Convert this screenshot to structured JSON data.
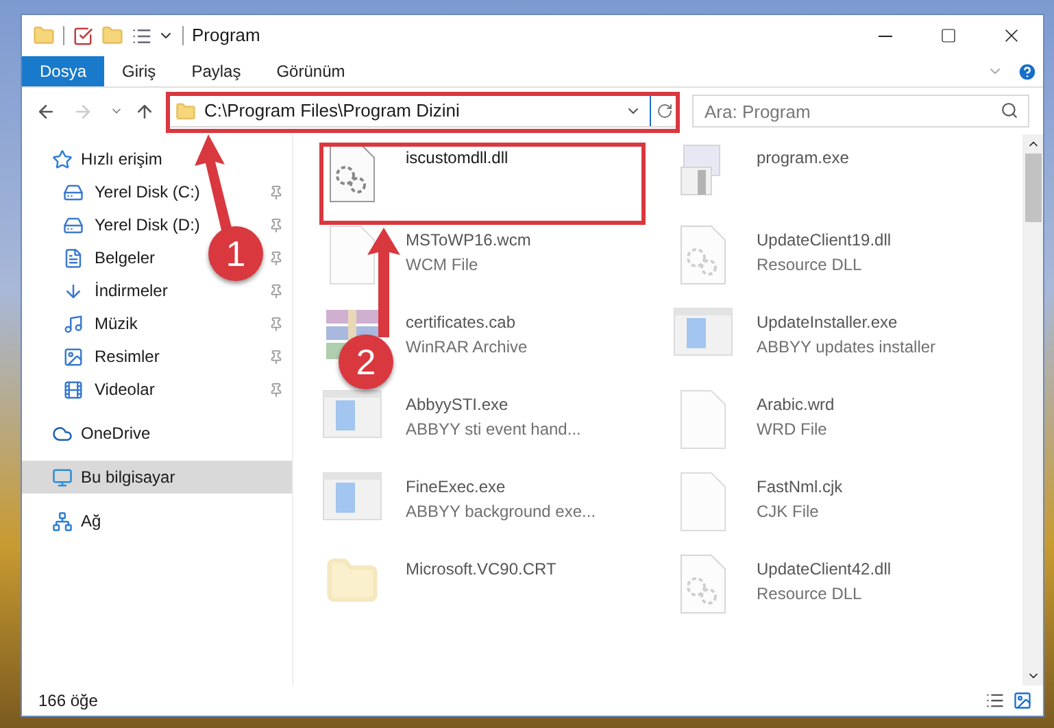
{
  "window": {
    "title": "Program"
  },
  "ribbon_tabs": [
    {
      "label": "Dosya",
      "selected": true
    },
    {
      "label": "Giriş",
      "selected": false
    },
    {
      "label": "Paylaş",
      "selected": false
    },
    {
      "label": "Görünüm",
      "selected": false
    }
  ],
  "address_bar": {
    "path": "C:\\Program Files\\Program Dizini"
  },
  "search": {
    "placeholder": "Ara: Program"
  },
  "sidebar": {
    "items": [
      {
        "label": "Hızlı erişim",
        "selected": false,
        "children": [
          {
            "label": "Yerel Disk (C:)",
            "pinned": true
          },
          {
            "label": "Yerel Disk (D:)",
            "pinned": true
          },
          {
            "label": "Belgeler",
            "pinned": true
          },
          {
            "label": "İndirmeler",
            "pinned": true
          },
          {
            "label": "Müzik",
            "pinned": true
          },
          {
            "label": "Resimler",
            "pinned": true
          },
          {
            "label": "Videolar",
            "pinned": true
          }
        ]
      },
      {
        "label": "OneDrive",
        "selected": false
      },
      {
        "label": "Bu bilgisayar",
        "selected": true
      },
      {
        "label": "Ağ",
        "selected": false
      }
    ]
  },
  "files": [
    {
      "name": "iscustomdll.dll",
      "kind": "dll",
      "blurred": false
    },
    {
      "name": "program.exe",
      "kind": "exe",
      "blurred": true
    },
    {
      "name": "MSToWP16.wcm",
      "type": "WCM File",
      "kind": "file",
      "blurred": true
    },
    {
      "name": "UpdateClient19.dll",
      "type": "Resource DLL",
      "kind": "dll",
      "blurred": true
    },
    {
      "name": "certificates.cab",
      "type": "WinRAR Archive",
      "kind": "archive",
      "blurred": true
    },
    {
      "name": "UpdateInstaller.exe",
      "type": "ABBYY updates installer",
      "kind": "app",
      "blurred": true
    },
    {
      "name": "AbbyySTI.exe",
      "type": "ABBYY sti event hand...",
      "kind": "app",
      "blurred": true
    },
    {
      "name": "Arabic.wrd",
      "type": "WRD File",
      "kind": "file",
      "blurred": true
    },
    {
      "name": "FineExec.exe",
      "type": "ABBYY background exe...",
      "kind": "app",
      "blurred": true
    },
    {
      "name": "FastNml.cjk",
      "type": "CJK File",
      "kind": "file",
      "blurred": true
    },
    {
      "name": "Microsoft.VC90.CRT",
      "kind": "folder",
      "blurred": true
    },
    {
      "name": "UpdateClient42.dll",
      "type": "Resource DLL",
      "kind": "dll",
      "blurred": true
    }
  ],
  "annotations": [
    {
      "label": "1"
    },
    {
      "label": "2"
    }
  ],
  "status_bar": {
    "count": "166 öğe"
  }
}
